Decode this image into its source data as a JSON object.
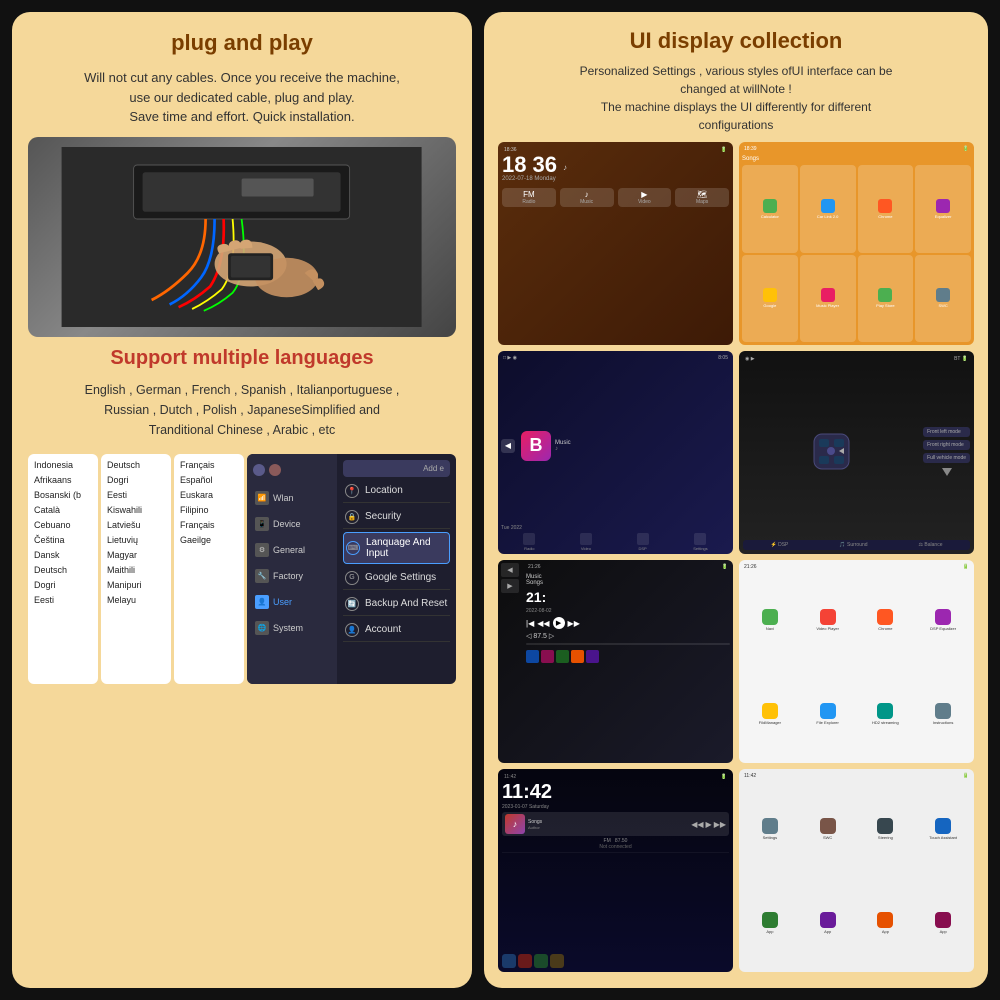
{
  "left": {
    "plug_title": "plug and play",
    "plug_desc": "Will not cut any cables. Once you receive the machine,\nuse our dedicated cable, plug and play.\nSave time and effort. Quick installation.",
    "support_title": "Support multiple languages",
    "support_desc": "English , German , French , Spanish , Italianportuguese ,\nRussian , Dutch , Polish , JapaneseSimplified and\nTranditional Chinese , Arabic , etc",
    "languages_col1": [
      "Indonesia",
      "Afrikaans",
      "Bosanski (b",
      "Català",
      "Cebuano",
      "Čeština",
      "Dansk",
      "Deutsch",
      "Dogri",
      "Eesti"
    ],
    "languages_col2": [
      "Deutsch",
      "Dogri",
      "Eesti",
      "Kiswahili",
      "Latviešu",
      "Lietuvių",
      "Magyar",
      "Maithili",
      "Manipuri",
      "Melayu"
    ],
    "languages_col3": [
      "Français",
      "Español",
      "Euskara",
      "Filipino",
      "Français",
      "Gaeilge"
    ],
    "settings_items": [
      {
        "icon": "📍",
        "label": "Location"
      },
      {
        "icon": "🔒",
        "label": "Security"
      },
      {
        "icon": "⌨",
        "label": "Lanquage And Input",
        "highlighted": true
      },
      {
        "icon": "⚙",
        "label": "Google Settings"
      },
      {
        "icon": "🔄",
        "label": "Backup And Reset"
      },
      {
        "icon": "👤",
        "label": "Account"
      }
    ],
    "nav_items": [
      {
        "icon": "📶",
        "label": "Wlan"
      },
      {
        "icon": "📱",
        "label": "Device"
      },
      {
        "icon": "⚙",
        "label": "General"
      },
      {
        "icon": "🔧",
        "label": "Factory"
      },
      {
        "icon": "👤",
        "label": "User",
        "active": true
      },
      {
        "icon": "🌐",
        "label": "System"
      }
    ]
  },
  "right": {
    "title": "UI display collection",
    "desc": "Personalized Settings , various styles ofUI interface can be\nchanged at willNote !\nThe machine displays the UI differently for different\nconfigurations",
    "screenshots": [
      {
        "id": "ss1",
        "label": "Clock Music UI",
        "time": "18 36"
      },
      {
        "id": "ss2",
        "label": "App Grid Orange"
      },
      {
        "id": "ss3",
        "label": "Bluetooth Dark"
      },
      {
        "id": "ss4",
        "label": "Car DSP"
      },
      {
        "id": "ss5",
        "label": "Music Player Dark"
      },
      {
        "id": "ss6",
        "label": "App Grid Light"
      },
      {
        "id": "ss7",
        "label": "Clock Dark"
      },
      {
        "id": "ss8",
        "label": "Settings Light"
      }
    ],
    "ss1_time": "18  36",
    "ss4_modes": [
      "Front left mode",
      "Front right mode",
      "Full vehicle mode"
    ],
    "ss4_eq_labels": [
      "DSP",
      "Surround",
      "Balance"
    ],
    "ss1_nav": [
      "Radio",
      "Music",
      "Video",
      "Maps"
    ],
    "ss3_bottom_labels": [
      "Radio",
      "Video",
      "DSP",
      "Settings"
    ]
  }
}
